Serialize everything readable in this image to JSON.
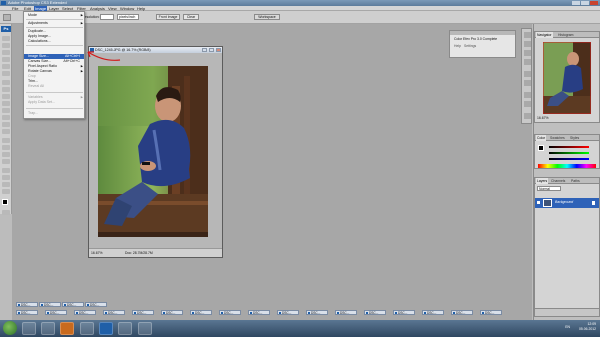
{
  "window": {
    "title": "Adobe Photoshop CS3 Extended"
  },
  "menubar": {
    "items": [
      "File",
      "Edit",
      "Image",
      "Layer",
      "Select",
      "Filter",
      "Analysis",
      "View",
      "Window",
      "Help"
    ],
    "active": "Image"
  },
  "options": {
    "resolution_label": "Resolution:",
    "resolution_unit": "pixels/inch",
    "front_image_button": "Front Image",
    "clear_button": "Clear",
    "workspace_label": "Workspace"
  },
  "image_menu": {
    "items": [
      {
        "label": "Mode",
        "shortcut": "",
        "submenu": true
      },
      {
        "label": "Adjustments",
        "shortcut": "",
        "submenu": true
      },
      {
        "label": "Duplicate...",
        "shortcut": ""
      },
      {
        "label": "Apply Image...",
        "shortcut": ""
      },
      {
        "label": "Calculations...",
        "shortcut": ""
      },
      {
        "label": "Image Size...",
        "shortcut": "Alt+Ctrl+I",
        "highlighted": true
      },
      {
        "label": "Canvas Size...",
        "shortcut": "Alt+Ctrl+C"
      },
      {
        "label": "Pixel Aspect Ratio",
        "shortcut": "",
        "submenu": true
      },
      {
        "label": "Rotate Canvas",
        "shortcut": "",
        "submenu": true
      },
      {
        "label": "Crop",
        "shortcut": "",
        "disabled": true
      },
      {
        "label": "Trim...",
        "shortcut": ""
      },
      {
        "label": "Reveal All",
        "shortcut": "",
        "disabled": true
      },
      {
        "label": "Variables",
        "shortcut": "",
        "submenu": true,
        "disabled": true
      },
      {
        "label": "Apply Data Set...",
        "shortcut": "",
        "disabled": true
      },
      {
        "label": "Trap...",
        "shortcut": "",
        "disabled": true
      }
    ]
  },
  "document": {
    "title": "DSC_1245.JPG @ 16.7% (RGB/8)",
    "zoom": "16.67%",
    "doc_info": "Doc: 28.7M/28.7M"
  },
  "efex_panel": {
    "title": "Color Efex Pro 3.0 Complete",
    "buttons": [
      "Help",
      "Settings"
    ]
  },
  "navigator_panel": {
    "tabs": [
      "Navigator",
      "Histogram"
    ],
    "zoom": "16.67%"
  },
  "color_panel": {
    "tabs": [
      "Color",
      "Swatches",
      "Styles"
    ]
  },
  "layers_panel": {
    "tabs": [
      "Layers",
      "Channels",
      "Paths"
    ],
    "blend_mode": "Normal",
    "layer_name": "Background"
  },
  "minimized_docs": {
    "label": "DSC...",
    "count": 22
  },
  "taskbar": {
    "language": "EN",
    "time": "12:09",
    "date": "05.06.2012"
  },
  "colors": {
    "accent": "#2e62b8",
    "annotation": "#d11c1c"
  }
}
